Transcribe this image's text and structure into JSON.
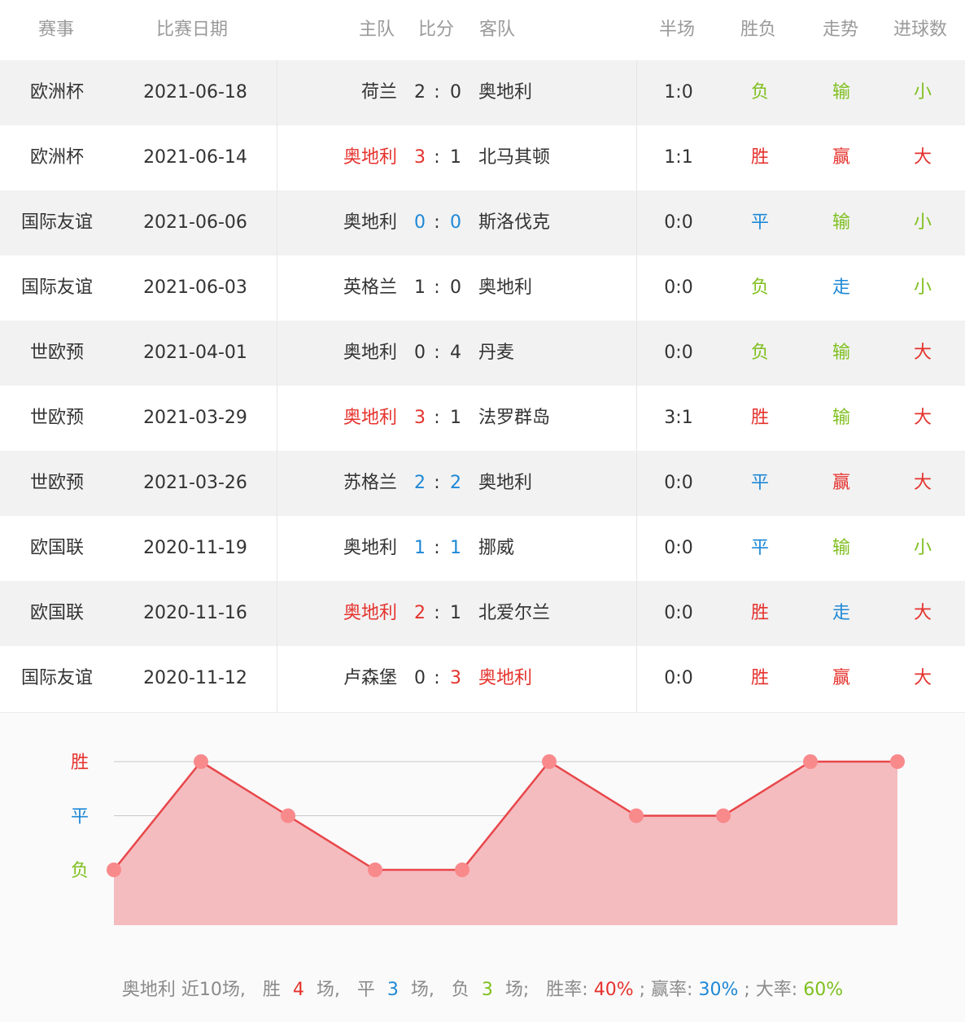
{
  "colors": {
    "win": "#e5322d",
    "draw": "#1e88d6",
    "loss": "#7fbf1f",
    "neutral": "#333333",
    "chart_line": "#e8474a",
    "chart_fill": "#f4bcbf",
    "chart_point": "#f88a8c"
  },
  "header": {
    "event": "赛事",
    "date": "比赛日期",
    "home": "主队",
    "score": "比分",
    "away": "客队",
    "half": "半场",
    "result": "胜负",
    "trend": "走势",
    "goals": "进球数"
  },
  "matches": [
    {
      "event": "欧洲杯",
      "date": "2021-06-18",
      "home": "荷兰",
      "hs": "2",
      "sep": ":",
      "as": "0",
      "away": "奥地利",
      "half": "1:0",
      "result": "负",
      "trend": "输",
      "goals": "小",
      "home_color": "neutral",
      "hs_color": "neutral",
      "as_color": "neutral",
      "away_color": "neutral",
      "result_color": "loss",
      "trend_color": "loss",
      "goals_color": "loss"
    },
    {
      "event": "欧洲杯",
      "date": "2021-06-14",
      "home": "奥地利",
      "hs": "3",
      "sep": ":",
      "as": "1",
      "away": "北马其顿",
      "half": "1:1",
      "result": "胜",
      "trend": "赢",
      "goals": "大",
      "home_color": "win",
      "hs_color": "win",
      "as_color": "neutral",
      "away_color": "neutral",
      "result_color": "win",
      "trend_color": "win",
      "goals_color": "win"
    },
    {
      "event": "国际友谊",
      "date": "2021-06-06",
      "home": "奥地利",
      "hs": "0",
      "sep": ":",
      "as": "0",
      "away": "斯洛伐克",
      "half": "0:0",
      "result": "平",
      "trend": "输",
      "goals": "小",
      "home_color": "neutral",
      "hs_color": "draw",
      "as_color": "draw",
      "away_color": "neutral",
      "result_color": "draw",
      "trend_color": "loss",
      "goals_color": "loss"
    },
    {
      "event": "国际友谊",
      "date": "2021-06-03",
      "home": "英格兰",
      "hs": "1",
      "sep": ":",
      "as": "0",
      "away": "奥地利",
      "half": "0:0",
      "result": "负",
      "trend": "走",
      "goals": "小",
      "home_color": "neutral",
      "hs_color": "neutral",
      "as_color": "neutral",
      "away_color": "neutral",
      "result_color": "loss",
      "trend_color": "draw",
      "goals_color": "loss"
    },
    {
      "event": "世欧预",
      "date": "2021-04-01",
      "home": "奥地利",
      "hs": "0",
      "sep": ":",
      "as": "4",
      "away": "丹麦",
      "half": "0:0",
      "result": "负",
      "trend": "输",
      "goals": "大",
      "home_color": "neutral",
      "hs_color": "neutral",
      "as_color": "neutral",
      "away_color": "neutral",
      "result_color": "loss",
      "trend_color": "loss",
      "goals_color": "win"
    },
    {
      "event": "世欧预",
      "date": "2021-03-29",
      "home": "奥地利",
      "hs": "3",
      "sep": ":",
      "as": "1",
      "away": "法罗群岛",
      "half": "3:1",
      "result": "胜",
      "trend": "输",
      "goals": "大",
      "home_color": "win",
      "hs_color": "win",
      "as_color": "neutral",
      "away_color": "neutral",
      "result_color": "win",
      "trend_color": "loss",
      "goals_color": "win"
    },
    {
      "event": "世欧预",
      "date": "2021-03-26",
      "home": "苏格兰",
      "hs": "2",
      "sep": ":",
      "as": "2",
      "away": "奥地利",
      "half": "0:0",
      "result": "平",
      "trend": "赢",
      "goals": "大",
      "home_color": "neutral",
      "hs_color": "draw",
      "as_color": "draw",
      "away_color": "neutral",
      "result_color": "draw",
      "trend_color": "win",
      "goals_color": "win"
    },
    {
      "event": "欧国联",
      "date": "2020-11-19",
      "home": "奥地利",
      "hs": "1",
      "sep": ":",
      "as": "1",
      "away": "挪威",
      "half": "0:0",
      "result": "平",
      "trend": "输",
      "goals": "小",
      "home_color": "neutral",
      "hs_color": "draw",
      "as_color": "draw",
      "away_color": "neutral",
      "result_color": "draw",
      "trend_color": "loss",
      "goals_color": "loss"
    },
    {
      "event": "欧国联",
      "date": "2020-11-16",
      "home": "奥地利",
      "hs": "2",
      "sep": ":",
      "as": "1",
      "away": "北爱尔兰",
      "half": "0:0",
      "result": "胜",
      "trend": "走",
      "goals": "大",
      "home_color": "win",
      "hs_color": "win",
      "as_color": "neutral",
      "away_color": "neutral",
      "result_color": "win",
      "trend_color": "draw",
      "goals_color": "win"
    },
    {
      "event": "国际友谊",
      "date": "2020-11-12",
      "home": "卢森堡",
      "hs": "0",
      "sep": ":",
      "as": "3",
      "away": "奥地利",
      "half": "0:0",
      "result": "胜",
      "trend": "赢",
      "goals": "大",
      "home_color": "neutral",
      "hs_color": "neutral",
      "as_color": "win",
      "away_color": "win",
      "result_color": "win",
      "trend_color": "win",
      "goals_color": "win"
    }
  ],
  "chart_data": {
    "type": "area",
    "y_categories": [
      "负",
      "平",
      "胜"
    ],
    "y_label_colors": [
      "loss",
      "draw",
      "win"
    ],
    "values": [
      0,
      2,
      1,
      0,
      0,
      2,
      1,
      1,
      2,
      2
    ],
    "ylim": [
      0,
      2
    ],
    "grid": true
  },
  "summary": {
    "team": "奥地利",
    "recent": "近10场,",
    "win_label": "胜",
    "win_count": "4",
    "win_unit": "场,",
    "draw_label": "平",
    "draw_count": "3",
    "draw_unit": "场,",
    "loss_label": "负",
    "loss_count": "3",
    "loss_unit": "场;",
    "win_rate_label": "胜率:",
    "win_rate": "40%",
    "sep1": ";",
    "ying_rate_label": "赢率:",
    "ying_rate": "30%",
    "sep2": ";",
    "da_rate_label": "大率:",
    "da_rate": "60%"
  }
}
